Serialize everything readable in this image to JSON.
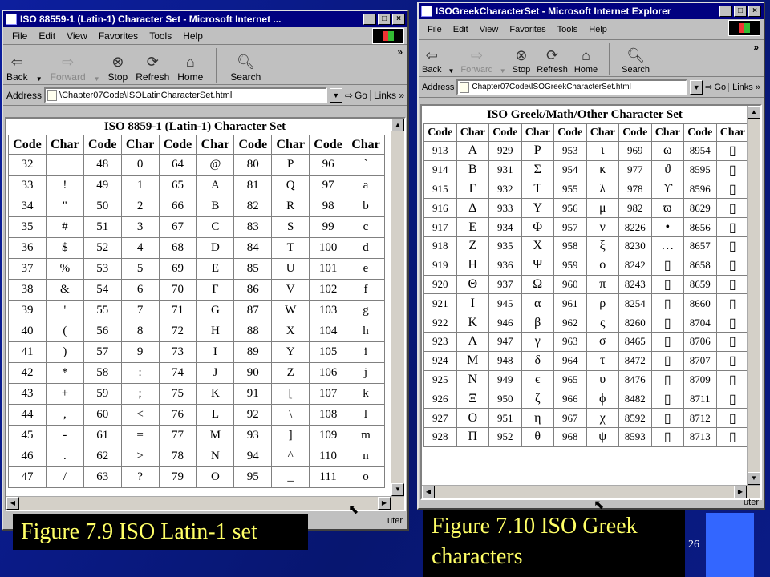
{
  "latin": {
    "title": "ISO 88559-1 (Latin-1) Character Set - Microsoft Internet ...",
    "menu": [
      "File",
      "Edit",
      "View",
      "Favorites",
      "Tools",
      "Help"
    ],
    "toolbar": {
      "back": "Back",
      "forward": "Forward",
      "stop": "Stop",
      "refresh": "Refresh",
      "home": "Home",
      "search": "Search"
    },
    "address_label": "Address",
    "address_value": "\\Chapter07Code\\ISOLatinCharacterSet.html",
    "go_label": "Go",
    "links_label": "Links",
    "table_caption": "ISO 8859-1 (Latin-1) Character Set",
    "headers": [
      "Code",
      "Char",
      "Code",
      "Char",
      "Code",
      "Char",
      "Code",
      "Char",
      "Code",
      "Char"
    ],
    "rows": [
      [
        "32",
        "",
        "48",
        "0",
        "64",
        "@",
        "80",
        "P",
        "96",
        "`"
      ],
      [
        "33",
        "!",
        "49",
        "1",
        "65",
        "A",
        "81",
        "Q",
        "97",
        "a"
      ],
      [
        "34",
        "\"",
        "50",
        "2",
        "66",
        "B",
        "82",
        "R",
        "98",
        "b"
      ],
      [
        "35",
        "#",
        "51",
        "3",
        "67",
        "C",
        "83",
        "S",
        "99",
        "c"
      ],
      [
        "36",
        "$",
        "52",
        "4",
        "68",
        "D",
        "84",
        "T",
        "100",
        "d"
      ],
      [
        "37",
        "%",
        "53",
        "5",
        "69",
        "E",
        "85",
        "U",
        "101",
        "e"
      ],
      [
        "38",
        "&",
        "54",
        "6",
        "70",
        "F",
        "86",
        "V",
        "102",
        "f"
      ],
      [
        "39",
        "'",
        "55",
        "7",
        "71",
        "G",
        "87",
        "W",
        "103",
        "g"
      ],
      [
        "40",
        "(",
        "56",
        "8",
        "72",
        "H",
        "88",
        "X",
        "104",
        "h"
      ],
      [
        "41",
        ")",
        "57",
        "9",
        "73",
        "I",
        "89",
        "Y",
        "105",
        "i"
      ],
      [
        "42",
        "*",
        "58",
        ":",
        "74",
        "J",
        "90",
        "Z",
        "106",
        "j"
      ],
      [
        "43",
        "+",
        "59",
        ";",
        "75",
        "K",
        "91",
        "[",
        "107",
        "k"
      ],
      [
        "44",
        ",",
        "60",
        "<",
        "76",
        "L",
        "92",
        "\\",
        "108",
        "l"
      ],
      [
        "45",
        "-",
        "61",
        "=",
        "77",
        "M",
        "93",
        "]",
        "109",
        "m"
      ],
      [
        "46",
        ".",
        "62",
        ">",
        "78",
        "N",
        "94",
        "^",
        "110",
        "n"
      ],
      [
        "47",
        "/",
        "63",
        "?",
        "79",
        "O",
        "95",
        "_",
        "111",
        "o"
      ]
    ],
    "status_text": "uter"
  },
  "greek": {
    "title": "ISOGreekCharacterSet - Microsoft Internet Explorer",
    "menu": [
      "File",
      "Edit",
      "View",
      "Favorites",
      "Tools",
      "Help"
    ],
    "toolbar": {
      "back": "Back",
      "forward": "Forward",
      "stop": "Stop",
      "refresh": "Refresh",
      "home": "Home",
      "search": "Search"
    },
    "address_label": "Address",
    "address_value": "Chapter07Code\\ISOGreekCharacterSet.html",
    "go_label": "Go",
    "links_label": "Links",
    "table_caption": "ISO Greek/Math/Other Character Set",
    "headers": [
      "Code",
      "Char",
      "Code",
      "Char",
      "Code",
      "Char",
      "Code",
      "Char",
      "Code",
      "Char"
    ],
    "rows": [
      [
        "913",
        "Α",
        "929",
        "Ρ",
        "953",
        "ι",
        "969",
        "ω",
        "8954",
        "▯"
      ],
      [
        "914",
        "Β",
        "931",
        "Σ",
        "954",
        "κ",
        "977",
        "ϑ",
        "8595",
        "▯"
      ],
      [
        "915",
        "Γ",
        "932",
        "Τ",
        "955",
        "λ",
        "978",
        "ϒ",
        "8596",
        "▯"
      ],
      [
        "916",
        "Δ",
        "933",
        "Υ",
        "956",
        "μ",
        "982",
        "ϖ",
        "8629",
        "▯"
      ],
      [
        "917",
        "Ε",
        "934",
        "Φ",
        "957",
        "ν",
        "8226",
        "•",
        "8656",
        "▯"
      ],
      [
        "918",
        "Ζ",
        "935",
        "Χ",
        "958",
        "ξ",
        "8230",
        "…",
        "8657",
        "▯"
      ],
      [
        "919",
        "Η",
        "936",
        "Ψ",
        "959",
        "ο",
        "8242",
        "▯",
        "8658",
        "▯"
      ],
      [
        "920",
        "Θ",
        "937",
        "Ω",
        "960",
        "π",
        "8243",
        "▯",
        "8659",
        "▯"
      ],
      [
        "921",
        "Ι",
        "945",
        "α",
        "961",
        "ρ",
        "8254",
        "▯",
        "8660",
        "▯"
      ],
      [
        "922",
        "Κ",
        "946",
        "β",
        "962",
        "ς",
        "8260",
        "▯",
        "8704",
        "▯"
      ],
      [
        "923",
        "Λ",
        "947",
        "γ",
        "963",
        "σ",
        "8465",
        "▯",
        "8706",
        "▯"
      ],
      [
        "924",
        "Μ",
        "948",
        "δ",
        "964",
        "τ",
        "8472",
        "▯",
        "8707",
        "▯"
      ],
      [
        "925",
        "Ν",
        "949",
        "ϵ",
        "965",
        "υ",
        "8476",
        "▯",
        "8709",
        "▯"
      ],
      [
        "926",
        "Ξ",
        "950",
        "ζ",
        "966",
        "ϕ",
        "8482",
        "▯",
        "8711",
        "▯"
      ],
      [
        "927",
        "Ο",
        "951",
        "η",
        "967",
        "χ",
        "8592",
        "▯",
        "8712",
        "▯"
      ],
      [
        "928",
        "Π",
        "952",
        "θ",
        "968",
        "ψ",
        "8593",
        "▯",
        "8713",
        "▯"
      ]
    ],
    "status_text": "uter"
  },
  "captions": {
    "latin": "Figure 7.9 ISO Latin-1 set",
    "greek": "Figure 7.10 ISO Greek characters"
  },
  "page_number": "26",
  "colors": {
    "caption_text": "#ffff66",
    "title_bar": "#000080",
    "slide_bg": "#0a1a8c",
    "accent_block": "#3366ff"
  }
}
